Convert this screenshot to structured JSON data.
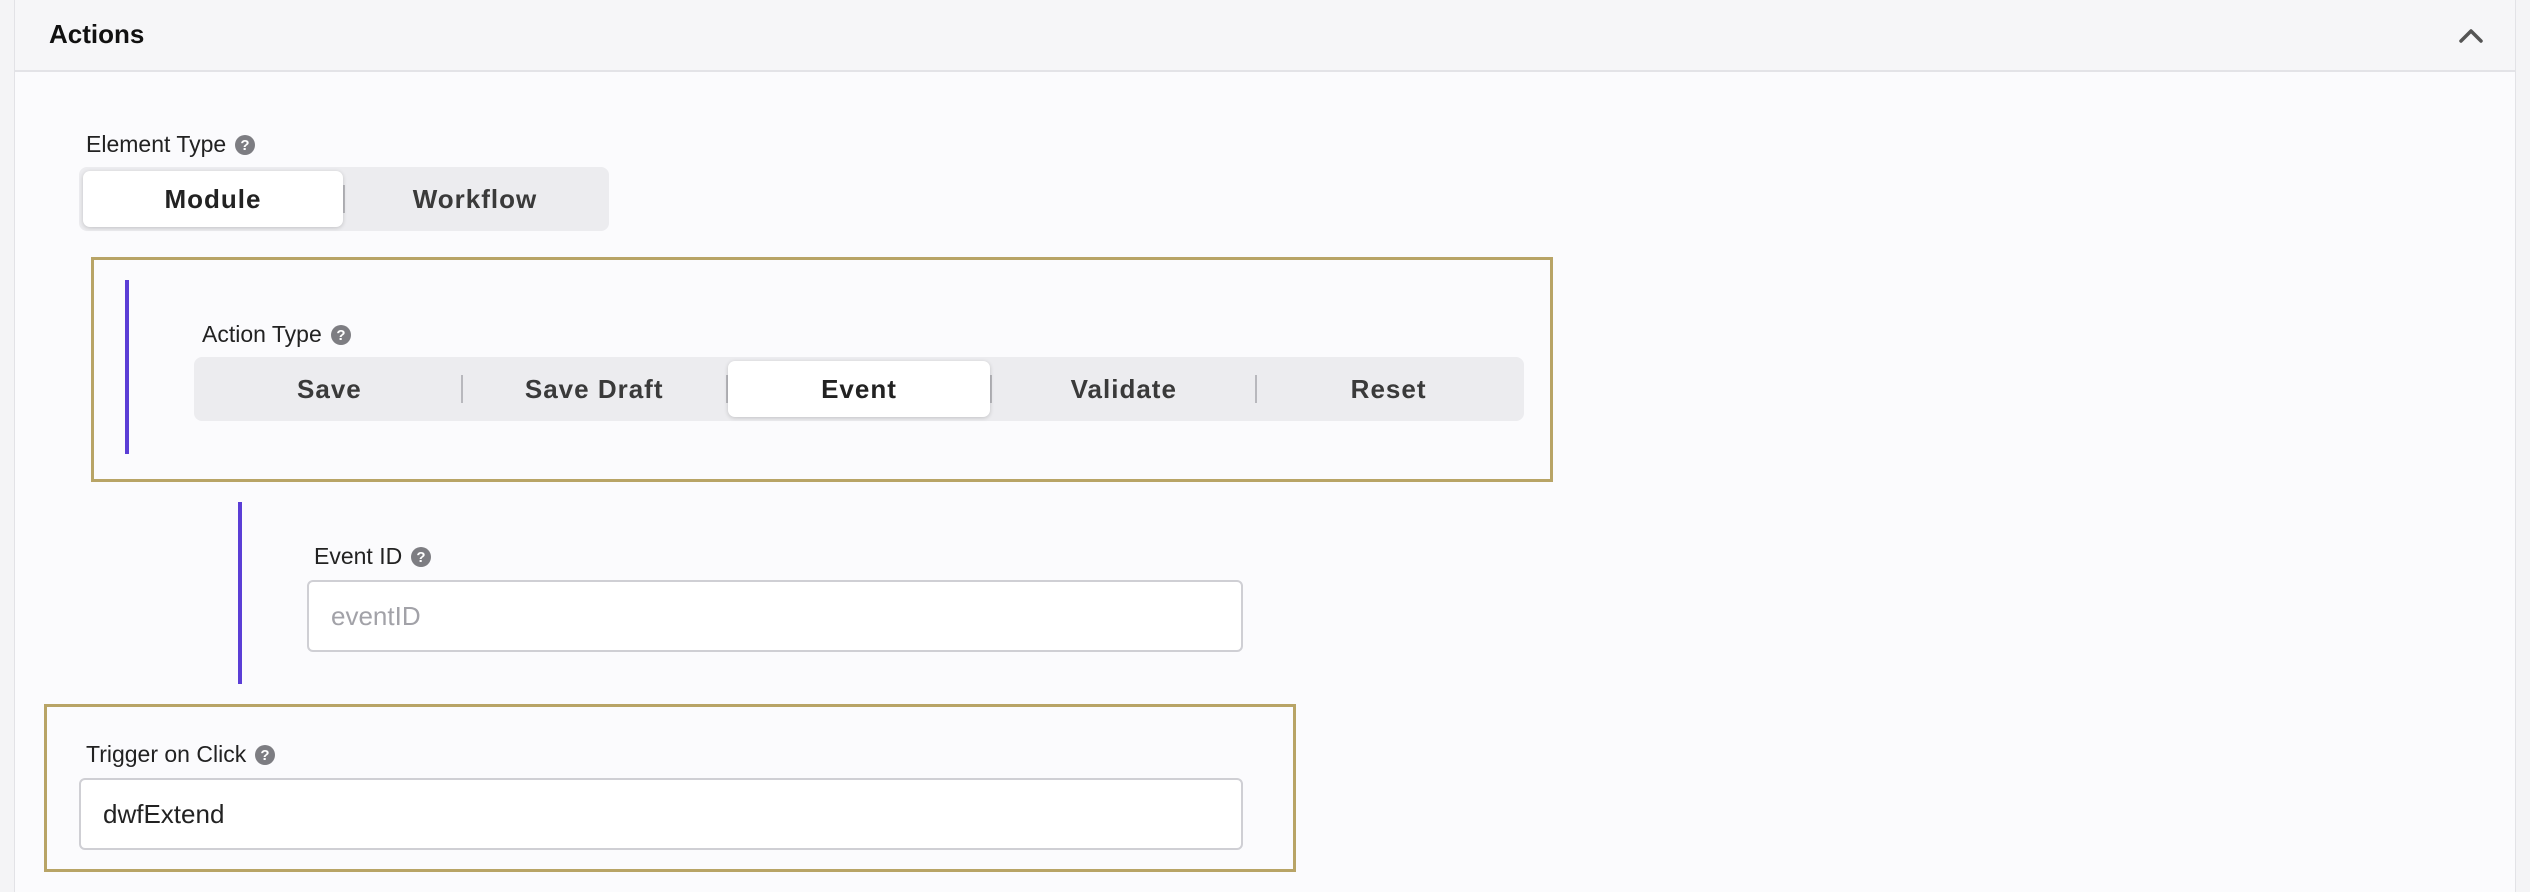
{
  "header": {
    "title": "Actions",
    "collapse_icon": "chevron-up-icon"
  },
  "element_type": {
    "label": "Element Type",
    "options": [
      "Module",
      "Workflow"
    ],
    "selected": "Module"
  },
  "action_type": {
    "label": "Action Type",
    "options": [
      "Save",
      "Save Draft",
      "Event",
      "Validate",
      "Reset"
    ],
    "selected": "Event"
  },
  "event_id": {
    "label": "Event ID",
    "value": "",
    "placeholder": "eventID"
  },
  "trigger_on_click": {
    "label": "Trigger on Click",
    "value": "dwfExtend",
    "placeholder": ""
  },
  "colors": {
    "highlight_border": "#b8a466",
    "accent_bar": "#5b3ed6",
    "segment_bg": "#ececef"
  },
  "icons": {
    "help": "question-circle-icon"
  }
}
